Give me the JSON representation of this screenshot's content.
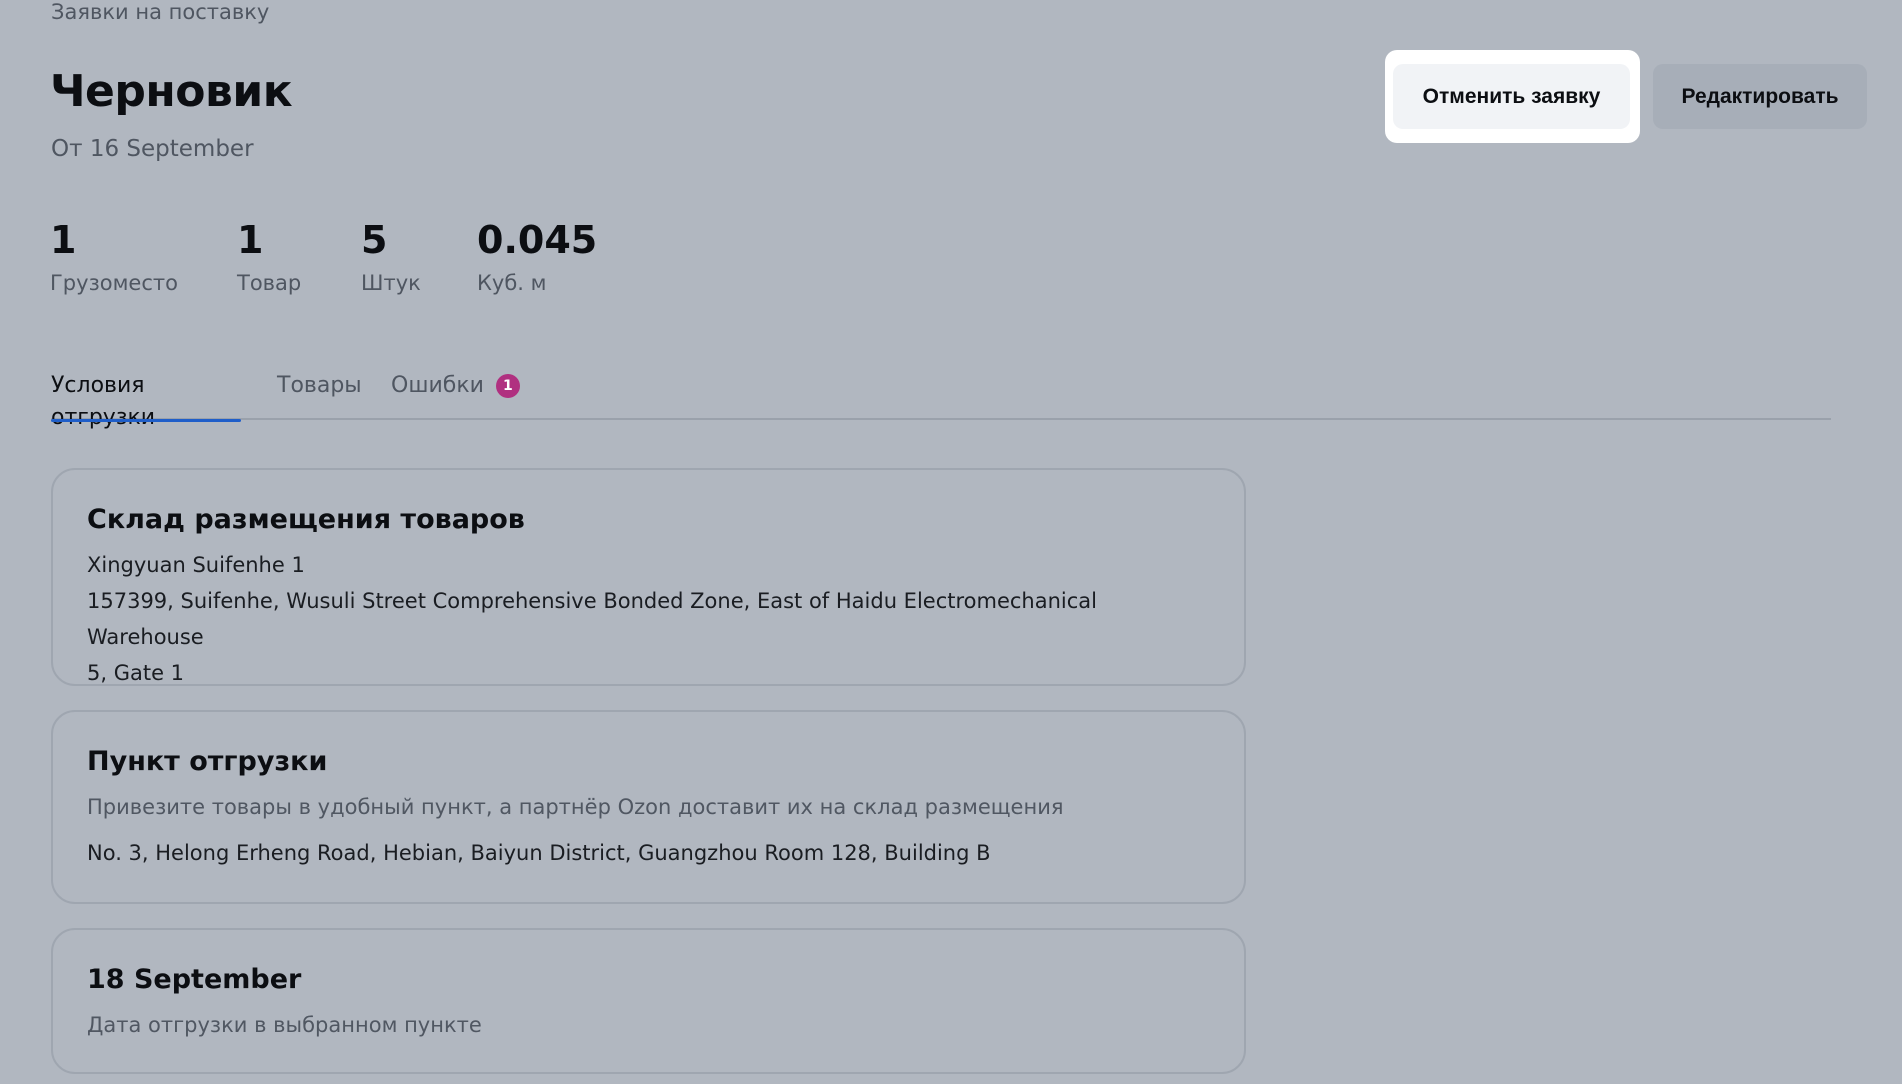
{
  "breadcrumb": "Заявки на поставку",
  "header": {
    "title": "Черновик",
    "subtitle": "От 16 September",
    "cancel_label": "Отменить заявку",
    "edit_label": "Редактировать"
  },
  "stats": [
    {
      "value": "1",
      "label": "Грузоместо"
    },
    {
      "value": "1",
      "label": "Товар"
    },
    {
      "value": "5",
      "label": "Штук"
    },
    {
      "value": "0.045",
      "label": "Куб. м"
    }
  ],
  "tabs": [
    {
      "label": "Условия отгрузки",
      "active": true
    },
    {
      "label": "Товары"
    },
    {
      "label": "Ошибки",
      "badge": "1"
    }
  ],
  "cards": {
    "warehouse": {
      "title": "Склад размещения товаров",
      "name": "Xingyuan Suifenhe 1",
      "address_line1": "157399, Suifenhe, Wusuli Street Comprehensive Bonded Zone, East of Haidu Electromechanical Warehouse",
      "address_line2": "5, Gate 1"
    },
    "pickup": {
      "title": "Пункт отгрузки",
      "hint": "Привезите товары в удобный пункт, а партнёр Ozon доставит их на склад размещения",
      "address": "No. 3, Helong Erheng Road, Hebian, Baiyun District, Guangzhou Room 128, Building B"
    },
    "date": {
      "title": "18 September",
      "hint": "Дата отгрузки в выбранном пункте"
    }
  },
  "colors": {
    "background": "#b1b7c0",
    "active_tab_underline": "#1f5ec9",
    "error_badge": "#b03080"
  }
}
